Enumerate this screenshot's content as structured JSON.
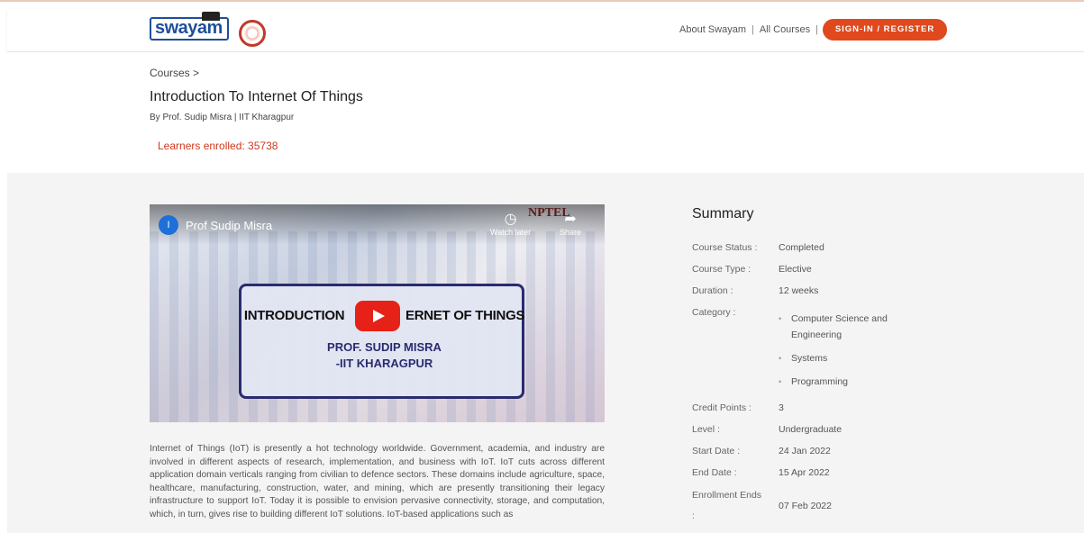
{
  "header": {
    "logo_text": "swayam",
    "nav": {
      "about": "About Swayam",
      "sep": "|",
      "all_courses": "All Courses",
      "sep2": "|"
    },
    "signin_label": "SIGN-IN / REGISTER",
    "accent_color": "#e0481e"
  },
  "course": {
    "breadcrumb": "Courses  >",
    "title": "Introduction To Internet Of Things",
    "byline": "By Prof. Sudip Misra  |  IIT Kharagpur",
    "enrolled": "Learners enrolled: 35738"
  },
  "video": {
    "channel_initial": "I",
    "channel_name": "Prof Sudip Misra",
    "watermark": "NPTEL",
    "watch_later": "Watch later",
    "share": "Share",
    "card_title_left": "INTRODUCTION",
    "card_title_right": "ERNET OF THINGS",
    "card_prof": "PROF. SUDIP MISRA",
    "card_inst": "-IIT KHARAGPUR"
  },
  "description": "Internet of Things (IoT) is presently a hot technology worldwide. Government, academia, and industry are involved in different aspects of research, implementation, and business with IoT. IoT cuts across different application domain verticals ranging from civilian to defence sectors. These domains include agriculture, space, healthcare, manufacturing, construction, water, and mining, which are presently transitioning their legacy infrastructure to support IoT. Today it is possible to envision pervasive connectivity, storage, and computation, which, in turn, gives rise to building different IoT solutions. IoT-based applications such as",
  "summary": {
    "title": "Summary",
    "status_label": "Course Status :",
    "status_value": "Completed",
    "type_label": "Course Type :",
    "type_value": "Elective",
    "duration_label": "Duration :",
    "duration_value": "12 weeks",
    "category_label": "Category :",
    "categories": [
      "Computer Science and Engineering",
      "Systems",
      "Programming"
    ],
    "credit_label": "Credit Points :",
    "credit_value": "3",
    "level_label": "Level :",
    "level_value": "Undergraduate",
    "start_label": "Start Date :",
    "start_value": "24 Jan 2022",
    "end_label": "End Date :",
    "end_value": "15 Apr 2022",
    "enroll_end_label": "Enrollment Ends",
    "enroll_end_colon": ":",
    "enroll_end_value": "07 Feb 2022"
  }
}
